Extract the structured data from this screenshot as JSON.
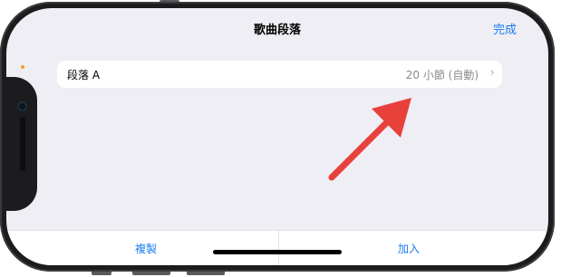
{
  "nav": {
    "title": "歌曲段落",
    "done_label": "完成"
  },
  "sections": [
    {
      "label": "段落 A",
      "value": "20 小節 (自動)",
      "chevron_icon": "chevron-right-icon"
    }
  ],
  "toolbar": {
    "copy_label": "複製",
    "add_label": "加入"
  },
  "colors": {
    "accent": "#1a7cf0",
    "annotation_arrow": "#e8413c",
    "background": "#efeef4"
  }
}
